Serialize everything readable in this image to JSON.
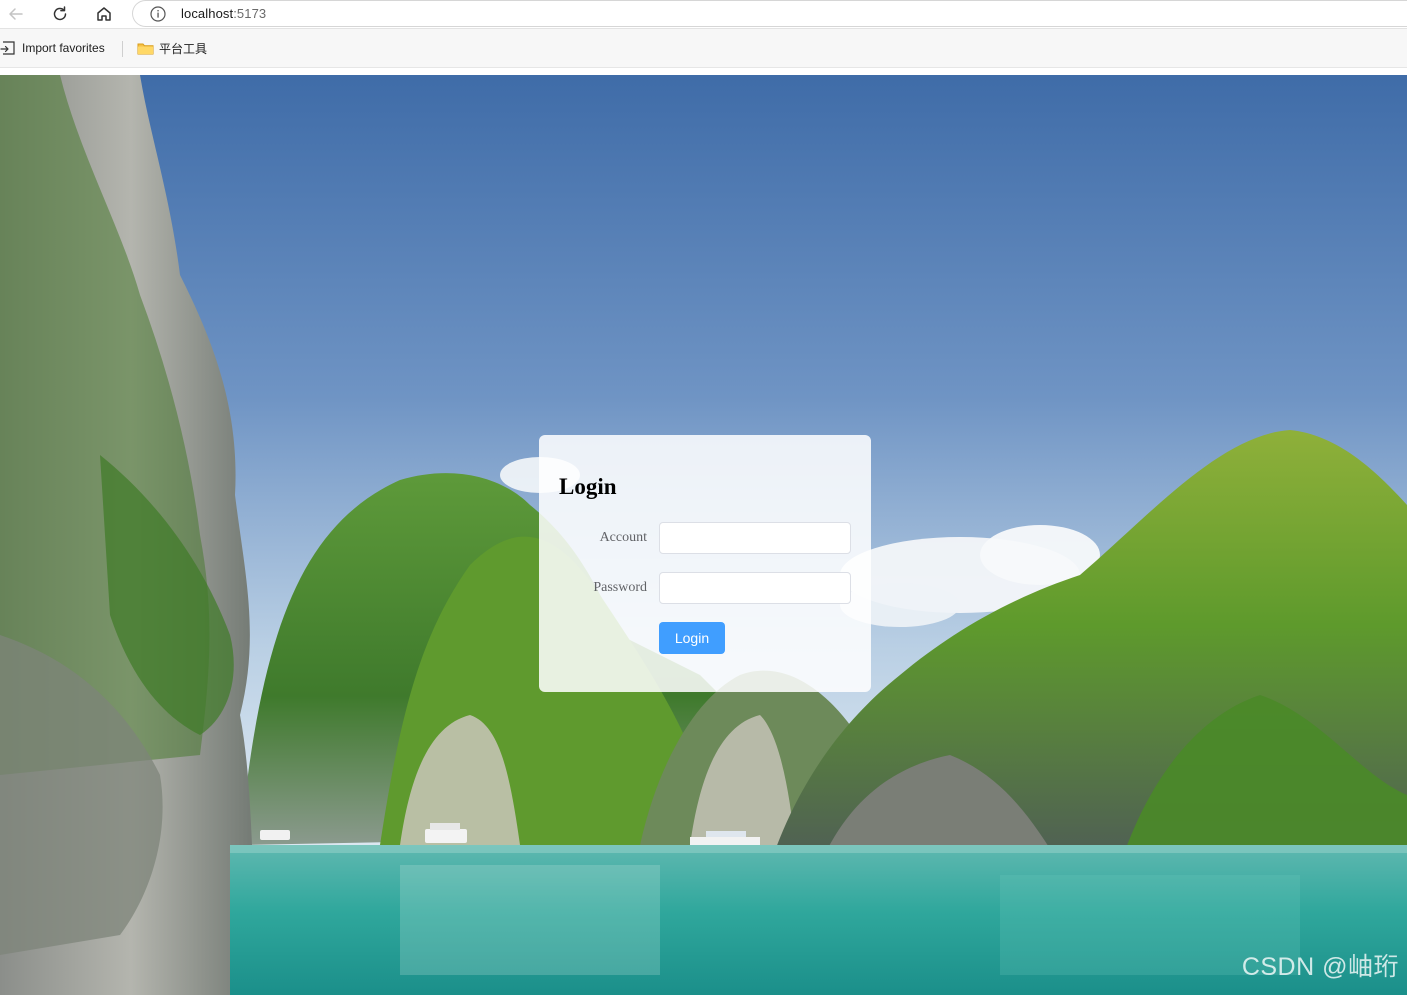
{
  "browser": {
    "url_host": "localhost",
    "url_port": ":5173",
    "bookmarks": [
      {
        "label": "Import favorites"
      },
      {
        "label": "平台工具"
      }
    ]
  },
  "login": {
    "title": "Login",
    "account_label": "Account",
    "account_value": "",
    "password_label": "Password",
    "password_value": "",
    "submit_label": "Login"
  },
  "watermark": "CSDN @岫珩",
  "colors": {
    "primary_button": "#409eff",
    "card_background": "rgba(255,255,255,0.86)"
  }
}
